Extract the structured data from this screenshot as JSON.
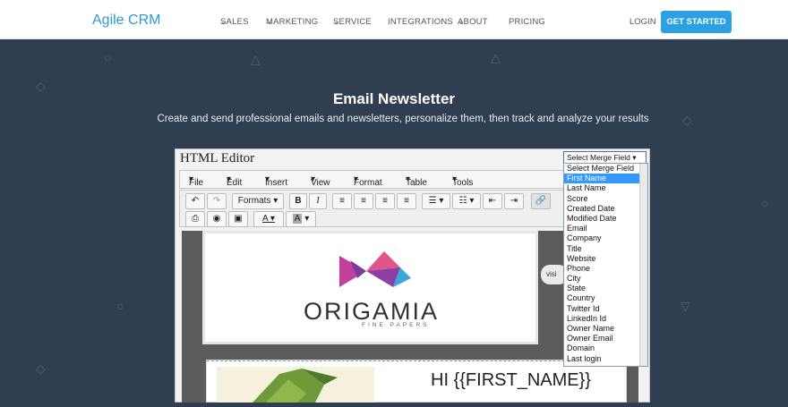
{
  "nav": {
    "brand": "Agile CRM",
    "items": [
      {
        "label": "SALES",
        "dropdown": true
      },
      {
        "label": "MARKETING",
        "dropdown": true
      },
      {
        "label": "SERVICE",
        "dropdown": true
      },
      {
        "label": "INTEGRATIONS",
        "dropdown": false
      },
      {
        "label": "ABOUT",
        "dropdown": true
      },
      {
        "label": "PRICING",
        "dropdown": false
      }
    ],
    "login": "LOGIN",
    "cta": "GET STARTED"
  },
  "hero": {
    "title": "Email Newsletter",
    "subtitle": "Create and send professional emails and newsletters, personalize them, then track and analyze your results"
  },
  "editor": {
    "title": "HTML Editor",
    "merge_select": "Select Merge Field",
    "menus": [
      "File",
      "Edit",
      "Insert",
      "View",
      "Format",
      "Table",
      "Tools"
    ],
    "formats_label": "Formats",
    "brand_wordmark": "ORIGAMIA",
    "brand_tagline": "FINE PAPERS",
    "greeting": "HI {{FIRST_NAME}}",
    "side_label": "visi"
  },
  "dropdown": {
    "options": [
      "Select Merge Field",
      "First Name",
      "Last Name",
      "Score",
      "Created Date",
      "Modified Date",
      "Email",
      "Company",
      "Title",
      "Website",
      "Phone",
      "City",
      "State",
      "Country",
      "Twitter Id",
      "LinkedIn Id",
      "Owner Name",
      "Owner Email",
      "Domain",
      "Last login"
    ],
    "selected": "First Name"
  },
  "colors": {
    "accent": "#2ba1e4",
    "hero_bg": "#2f3e51",
    "brand": "#2b9bd6"
  }
}
